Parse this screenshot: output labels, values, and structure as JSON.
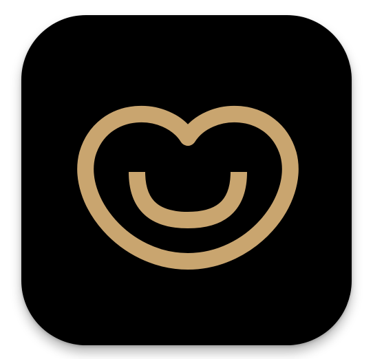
{
  "app_icon": {
    "icon_name": "smiling-heart-logo-icon",
    "background_color": "#000000",
    "logo_color": "#C9A56F"
  }
}
